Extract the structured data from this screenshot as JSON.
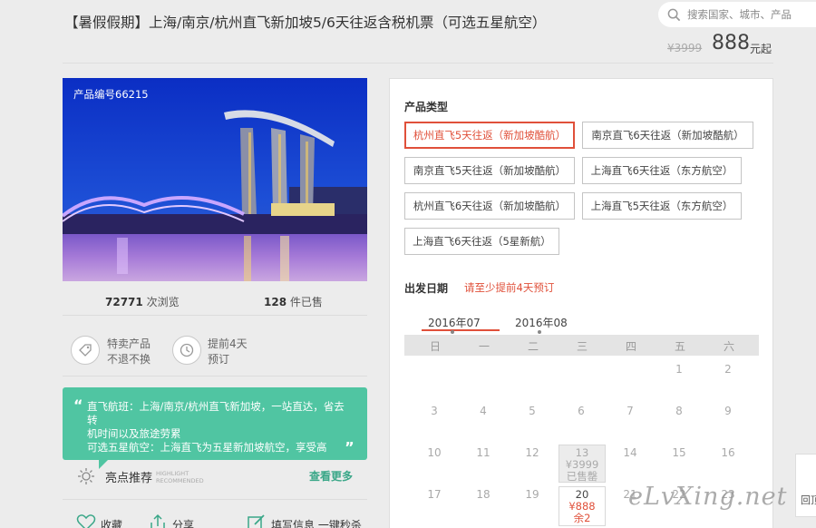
{
  "header": {
    "title": "【暑假假期】上海/南京/杭州直飞新加坡5/6天往返含税机票（可选五星航空）",
    "search_placeholder": "搜索国家、城市、产品",
    "original_price": "¥3999",
    "price": "888",
    "price_unit": "元起"
  },
  "gallery": {
    "product_no": "产品编号66215"
  },
  "stats": {
    "views_num": "72771",
    "views_label": "次浏览",
    "sold_num": "128",
    "sold_label": "件已售"
  },
  "features": [
    {
      "icon": "tag-icon",
      "line1": "特卖产品",
      "line2": "不退不换"
    },
    {
      "icon": "clock-icon",
      "line1": "提前4天",
      "line2": "预订"
    }
  ],
  "highlight_box": {
    "line1": "直飞航班：上海/南京/杭州直飞新加坡，一站直达，省去转",
    "line2": "机时间以及旅途劳累",
    "line3": "可选五星航空：上海直飞为五星新加坡航空，享受高"
  },
  "highlights": {
    "title": "亮点推荐",
    "title_en_1": "HIGHLIGHT",
    "title_en_2": "RECOMMENDED",
    "more": "查看更多"
  },
  "actions": {
    "favorite": "收藏",
    "share": "分享",
    "book": "填写信息 一键秒杀"
  },
  "product_types": {
    "heading": "产品类型",
    "options": [
      "杭州直飞5天往返（新加坡酷航）",
      "南京直飞6天往返（新加坡酷航）",
      "南京直飞5天往返（新加坡酷航）",
      "上海直飞6天往返（东方航空）",
      "杭州直飞6天往返（新加坡酷航）",
      "上海直飞5天往返（东方航空）",
      "上海直飞6天往返（5星新航）"
    ],
    "selected_index": 0
  },
  "departure": {
    "heading": "出发日期",
    "note": "请至少提前4天预订",
    "months": [
      "2016年07",
      "2016年08"
    ],
    "active_month": 0,
    "weekdays": [
      "日",
      "一",
      "二",
      "三",
      "四",
      "五",
      "六"
    ],
    "row1": [
      "",
      "",
      "",
      "",
      "",
      "1",
      "2"
    ],
    "row2": [
      "3",
      "4",
      "5",
      "6",
      "7",
      "8",
      "9"
    ],
    "row3": [
      "10",
      "11",
      "12",
      "13",
      "14",
      "15",
      "16"
    ],
    "row4": [
      "17",
      "18",
      "19",
      "20",
      "21",
      "22",
      "23"
    ],
    "sold_cell": {
      "day": "13",
      "price": "¥3999",
      "status": "已售罄"
    },
    "avail_cell": {
      "day": "20",
      "price": "¥888",
      "remaining": "余2"
    }
  },
  "watermark": "eLvXing.net",
  "back_to_top": "回顶"
}
